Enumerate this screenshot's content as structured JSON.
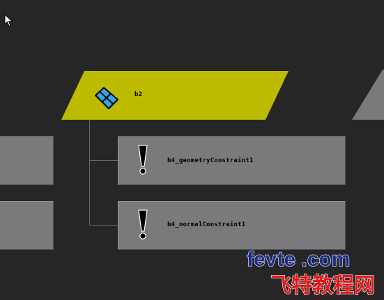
{
  "nodes": {
    "transform": {
      "label": "b2",
      "fill": "#bdbb00",
      "icon": "nurbs-surface-icon"
    },
    "constraints": [
      {
        "label": "b4_geometryConstraint1",
        "icon": "exclamation-icon"
      },
      {
        "label": "b4_normalConstraint1",
        "icon": "exclamation-icon"
      }
    ]
  },
  "watermark": {
    "line1": "fevte .com",
    "line2": "飞特教程网"
  },
  "colors": {
    "background": "#262626",
    "node_gray": "#7a7a7d",
    "selected_node": "#bdbb00",
    "icon_blue": "#33a4e6"
  }
}
